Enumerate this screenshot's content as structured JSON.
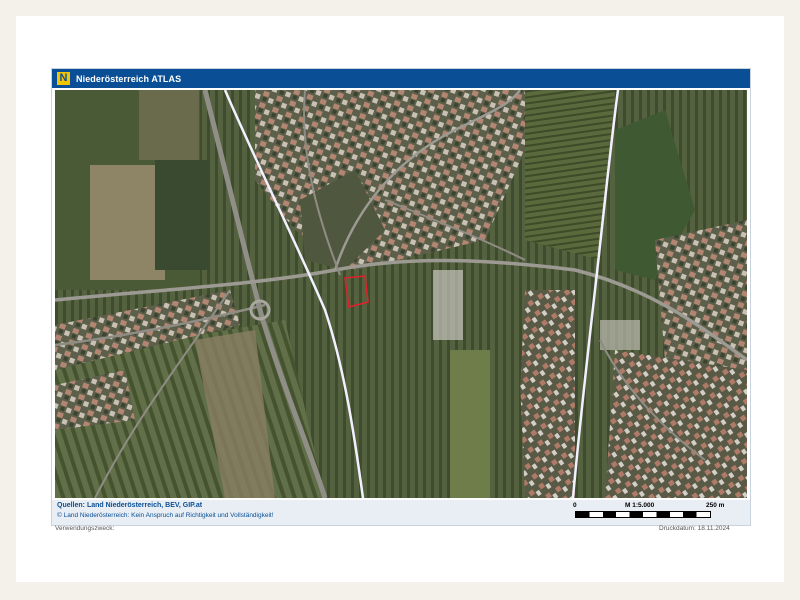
{
  "header": {
    "title": "Niederösterreich ATLAS",
    "logo_letter": "N",
    "logo_color": "#f3c400",
    "bar_color": "#0a4f96"
  },
  "footer": {
    "sources": "Quellen: Land Niederösterreich, BEV, GIP.at",
    "copyright": "© Land Niederösterreich: Kein Anspruch auf Richtigkeit und Vollständigkeit!"
  },
  "scale": {
    "start": "0",
    "ratio": "M 1:5.000",
    "end": "250 m"
  },
  "meta": {
    "purpose_label": "Verwendungszweck:",
    "print_date": "Druckdatum: 18.11.2024"
  },
  "map": {
    "marker_color": "#e0202a",
    "boundary_color": "#e8e6ff"
  }
}
